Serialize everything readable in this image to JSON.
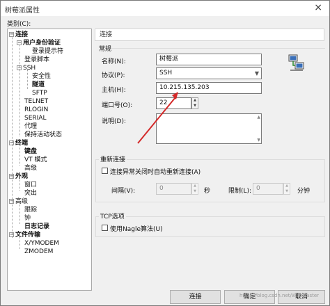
{
  "window": {
    "title": "树莓派属性",
    "close_glyph": "×"
  },
  "category_label": "类别(C):",
  "tree": [
    {
      "label": "连接",
      "bold": true,
      "expander": "−"
    },
    {
      "label": "用户身份验证",
      "bold": true,
      "expander": "−"
    },
    {
      "label": "登录提示符",
      "bold": false
    },
    {
      "label": "登录脚本",
      "bold": false
    },
    {
      "label": "SSH",
      "bold": false,
      "expander": "−"
    },
    {
      "label": "安全性",
      "bold": false
    },
    {
      "label": "隧道",
      "bold": true
    },
    {
      "label": "SFTP",
      "bold": false
    },
    {
      "label": "TELNET",
      "bold": false
    },
    {
      "label": "RLOGIN",
      "bold": false
    },
    {
      "label": "SERIAL",
      "bold": false
    },
    {
      "label": "代理",
      "bold": false
    },
    {
      "label": "保持活动状态",
      "bold": false
    },
    {
      "label": "终端",
      "bold": true,
      "expander": "−"
    },
    {
      "label": "键盘",
      "bold": true
    },
    {
      "label": "VT 模式",
      "bold": false
    },
    {
      "label": "高级",
      "bold": false
    },
    {
      "label": "外观",
      "bold": true,
      "expander": "−"
    },
    {
      "label": "窗口",
      "bold": false
    },
    {
      "label": "突出",
      "bold": false
    },
    {
      "label": "高级",
      "bold": false,
      "expander": "−"
    },
    {
      "label": "跟踪",
      "bold": false
    },
    {
      "label": "钟",
      "bold": false
    },
    {
      "label": "日志记录",
      "bold": true
    },
    {
      "label": "文件传输",
      "bold": true,
      "expander": "−"
    },
    {
      "label": "X/YMODEM",
      "bold": false
    },
    {
      "label": "ZMODEM",
      "bold": false
    }
  ],
  "panel_header": "连接",
  "general": {
    "title": "常规",
    "name_label": "名称(N):",
    "name_value": "树莓派",
    "protocol_label": "协议(P):",
    "protocol_value": "SSH",
    "host_label": "主机(H):",
    "host_value": "10.215.135.203",
    "port_label": "端口号(O):",
    "port_value": "22",
    "desc_label": "说明(D):",
    "desc_value": ""
  },
  "reconnect": {
    "title": "重新连接",
    "auto_label": "连接异常关闭时自动重新连接(A)",
    "interval_label": "间隔(V):",
    "interval_value": "0",
    "interval_unit": "秒",
    "limit_label": "限制(L):",
    "limit_value": "0",
    "limit_unit": "分钟"
  },
  "tcp": {
    "title": "TCP选项",
    "nagle_label": "使用Nagle算法(U)"
  },
  "buttons": {
    "connect": "连接",
    "ok": "确定",
    "cancel": "取消"
  },
  "watermark": "https://blog.csdn.net/WebMaster",
  "colors": {
    "arrow": "#d42a2a",
    "icon_blue": "#3a6fb8"
  }
}
